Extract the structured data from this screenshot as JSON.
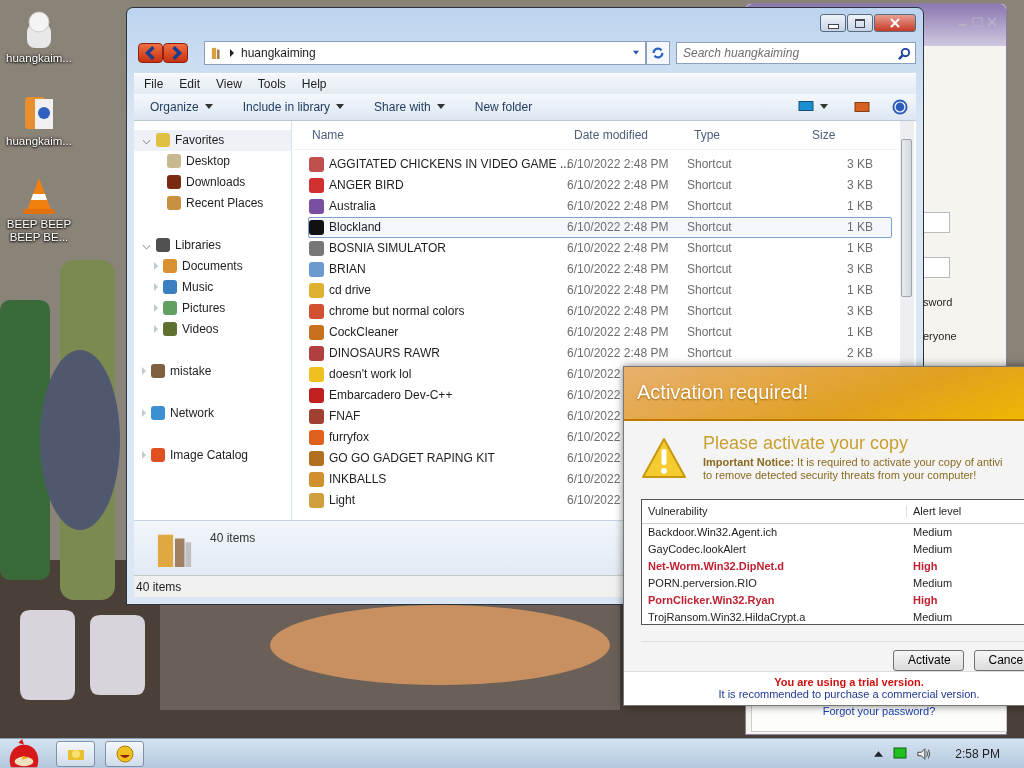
{
  "desktop_icons": [
    {
      "label": "huangkaim...",
      "kind": "mascot"
    },
    {
      "label": "huangkaim...",
      "kind": "album"
    },
    {
      "label": "BEEP BEEP BEEP BE...",
      "kind": "cone"
    }
  ],
  "back_window": {
    "texts": [
      "sword",
      "eryone"
    ],
    "link": "Forgot your password?"
  },
  "explorer": {
    "address": "huangkaiming",
    "search": {
      "placeholder": "Search huangkaiming"
    },
    "menu": [
      "File",
      "Edit",
      "View",
      "Tools",
      "Help"
    ],
    "commands": [
      {
        "label": "Organize",
        "dropdown": true
      },
      {
        "label": "Include in library",
        "dropdown": true
      },
      {
        "label": "Share with",
        "dropdown": true
      },
      {
        "label": "New folder",
        "dropdown": false
      }
    ],
    "nav": [
      {
        "label": "Favorites",
        "kind": "star",
        "expanded": true,
        "children": [
          {
            "label": "Desktop",
            "kind": "desk"
          },
          {
            "label": "Downloads",
            "kind": "down"
          },
          {
            "label": "Recent Places",
            "kind": "recent"
          }
        ]
      },
      {
        "label": "Libraries",
        "kind": "lib",
        "expanded": true,
        "children": [
          {
            "label": "Documents",
            "kind": "doc",
            "expanded": false
          },
          {
            "label": "Music",
            "kind": "music",
            "expanded": false
          },
          {
            "label": "Pictures",
            "kind": "pic",
            "expanded": false
          },
          {
            "label": "Videos",
            "kind": "vid",
            "expanded": false
          }
        ]
      },
      {
        "label": "mistake",
        "kind": "user",
        "expanded": false
      },
      {
        "label": "Network",
        "kind": "net",
        "expanded": false
      },
      {
        "label": "Image Catalog",
        "kind": "cat",
        "expanded": false
      }
    ],
    "columns": [
      "Name",
      "Date modified",
      "Type",
      "Size"
    ],
    "files": [
      {
        "name": "AGGITATED CHICKENS IN VIDEO GAME ...",
        "date": "6/10/2022 2:48 PM",
        "type": "Shortcut",
        "size": "3 KB",
        "selected": false,
        "color": "#c0504d"
      },
      {
        "name": "ANGER BIRD",
        "date": "6/10/2022 2:48 PM",
        "type": "Shortcut",
        "size": "3 KB",
        "selected": false,
        "color": "#d03030"
      },
      {
        "name": "Australia",
        "date": "6/10/2022 2:48 PM",
        "type": "Shortcut",
        "size": "1 KB",
        "selected": false,
        "color": "#7a4ea0"
      },
      {
        "name": "Blockland",
        "date": "6/10/2022 2:48 PM",
        "type": "Shortcut",
        "size": "1 KB",
        "selected": true,
        "color": "#111111"
      },
      {
        "name": "BOSNIA SIMULATOR",
        "date": "6/10/2022 2:48 PM",
        "type": "Shortcut",
        "size": "1 KB",
        "selected": false,
        "color": "#777777"
      },
      {
        "name": "BRIAN",
        "date": "6/10/2022 2:48 PM",
        "type": "Shortcut",
        "size": "3 KB",
        "selected": false,
        "color": "#6a9ad0"
      },
      {
        "name": "cd drive",
        "date": "6/10/2022 2:48 PM",
        "type": "Shortcut",
        "size": "1 KB",
        "selected": false,
        "color": "#e0b030"
      },
      {
        "name": "chrome but normal colors",
        "date": "6/10/2022 2:48 PM",
        "type": "Shortcut",
        "size": "3 KB",
        "selected": false,
        "color": "#d05030"
      },
      {
        "name": "CockCleaner",
        "date": "6/10/2022 2:48 PM",
        "type": "Shortcut",
        "size": "1 KB",
        "selected": false,
        "color": "#c87020"
      },
      {
        "name": "DINOSAURS RAWR",
        "date": "6/10/2022 2:48 PM",
        "type": "Shortcut",
        "size": "2 KB",
        "selected": false,
        "color": "#b04040"
      },
      {
        "name": "doesn't work lol",
        "date": "6/10/2022",
        "selected": false,
        "color": "#f0c020"
      },
      {
        "name": "Embarcadero Dev-C++",
        "date": "6/10/2022",
        "selected": false,
        "color": "#c02020"
      },
      {
        "name": "FNAF",
        "date": "6/10/2022",
        "selected": false,
        "color": "#a04030"
      },
      {
        "name": "furryfox",
        "date": "6/10/2022",
        "selected": false,
        "color": "#e06020"
      },
      {
        "name": "GO GO GADGET RAPING KIT",
        "date": "6/10/2022",
        "selected": false,
        "color": "#b07020"
      },
      {
        "name": "INKBALLS",
        "date": "6/10/2022",
        "selected": false,
        "color": "#d09030"
      },
      {
        "name": "Light",
        "date": "6/10/2022",
        "selected": false,
        "color": "#d0a040"
      }
    ],
    "details": "40 items",
    "status": "40 items"
  },
  "popup": {
    "title": "Activation required!",
    "heading": "Please activate your copy",
    "notice": [
      "**Important Notice:** It is required to activate your copy of antivi",
      "to remove detected security threats from your computer!"
    ],
    "columns": [
      "Vulnerability",
      "Alert level"
    ],
    "threats": [
      {
        "name": "Backdoor.Win32.Agent.ich",
        "alert": "Medium",
        "critical": false
      },
      {
        "name": "GayCodec.lookAlert",
        "alert": "Medium",
        "critical": false
      },
      {
        "name": "Net-Worm.Win32.DipNet.d",
        "alert": "High",
        "critical": true
      },
      {
        "name": "PORN.perversion.RIO",
        "alert": "Medium",
        "critical": false
      },
      {
        "name": "PornClicker.Win32.Ryan",
        "alert": "High",
        "critical": true
      },
      {
        "name": "TrojRansom.Win32.HildaCrypt.a",
        "alert": "Medium",
        "critical": false
      }
    ],
    "buttons": [
      "Activate",
      "Cance"
    ],
    "trial": "You are using a trial version.",
    "advice": "It is recommended to purchase a commercial version."
  },
  "taskbar": {
    "clock": "2:58 PM"
  }
}
